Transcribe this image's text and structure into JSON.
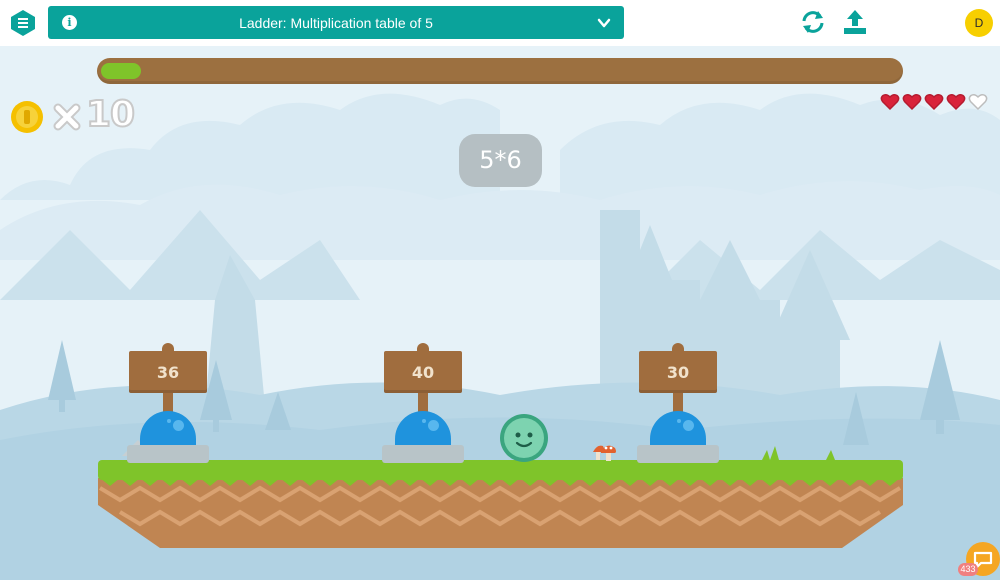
{
  "header": {
    "title": "Ladder: Multiplication table of 5",
    "avatar_initial": "D",
    "brand_color": "#0aa39b"
  },
  "game": {
    "progress": 0.05,
    "coins": "10",
    "lives_total": 5,
    "lives_remaining": 4,
    "question": "5*6",
    "answers": [
      "36",
      "40",
      "30"
    ],
    "chat_badge": "433"
  }
}
